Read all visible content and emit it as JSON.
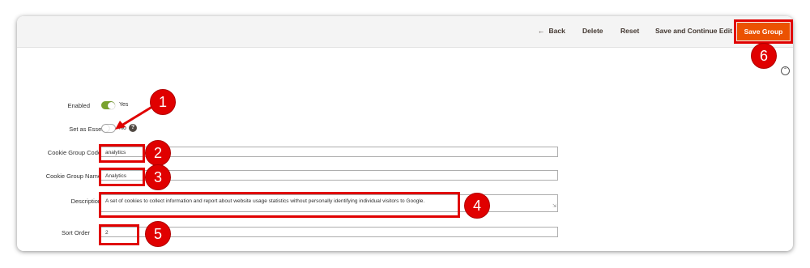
{
  "toolbar": {
    "back_label": "Back",
    "back_icon": "arrow-left-icon",
    "delete_label": "Delete",
    "reset_label": "Reset",
    "save_continue_label": "Save and Continue Edit",
    "save_group_label": "Save Group"
  },
  "form": {
    "enabled": {
      "label": "Enabled",
      "value": "Yes",
      "on": true
    },
    "essential": {
      "label": "Set as Essential",
      "value": "No",
      "on": false,
      "help": "?"
    },
    "code": {
      "label": "Cookie Group Code",
      "value": "analytics",
      "required": "*"
    },
    "name": {
      "label": "Cookie Group Name",
      "value": "Analytics",
      "required": "*"
    },
    "description": {
      "label": "Description",
      "value": "A set of cookies to collect information and report about website usage statistics without personally identifying individual visitors to Google.",
      "required": "*"
    },
    "sort_order": {
      "label": "Sort Order",
      "value": "2"
    }
  },
  "annotations": [
    "1",
    "2",
    "3",
    "4",
    "5",
    "6"
  ],
  "colors": {
    "accent": "#eb5202",
    "annotation": "#e00000",
    "toggle_on": "#79a22e"
  }
}
